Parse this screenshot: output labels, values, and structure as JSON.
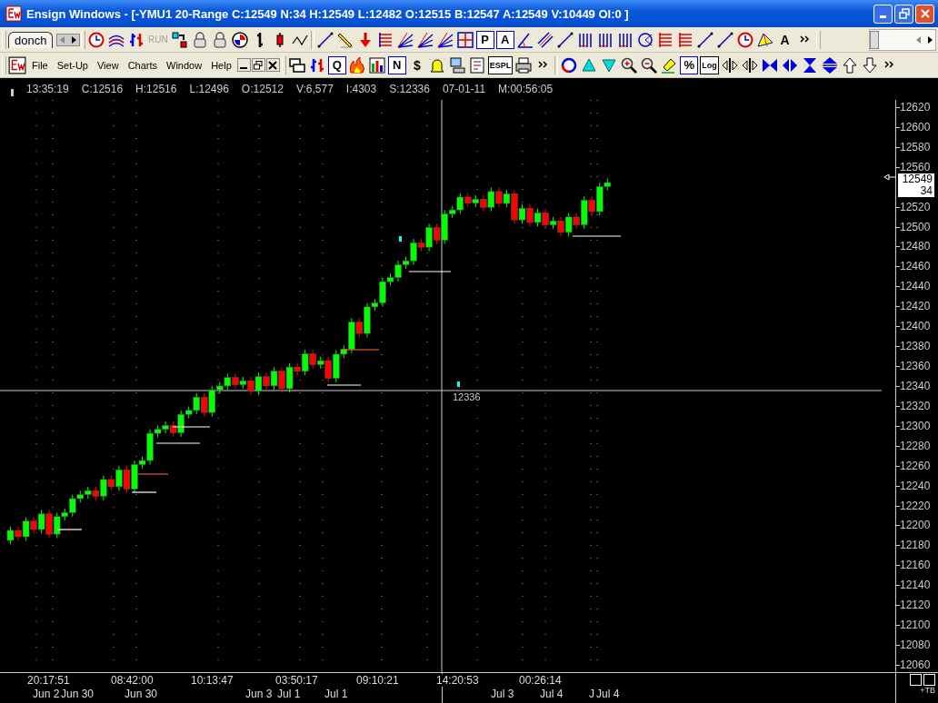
{
  "window": {
    "title": "Ensign Windows - [-YMU1 20-Range C:12549 N:34 H:12549 L:12482 O:12515 B:12547 A:12549 V:10449 OI:0 ]"
  },
  "chart_toolbar": {
    "tab": "donch",
    "glyphs": [
      "RUN",
      "P",
      "A",
      "A"
    ],
    "run_disabled": true
  },
  "menu": [
    "File",
    "Set-Up",
    "View",
    "Charts",
    "Window",
    "Help"
  ],
  "main_toolbar": {
    "glyphs": [
      "Q",
      "N",
      "$",
      "ESPL",
      "%",
      "Log"
    ]
  },
  "info_bar": [
    "13:35:19",
    "C:12516",
    "H:12516",
    "L:12496",
    "O:12512",
    "V:6,577",
    "I:4303",
    "S:12336",
    "07-01-11",
    "M:00:56:05"
  ],
  "price_axis": {
    "labels": [
      "12620",
      "12600",
      "12580",
      "12560",
      "12520",
      "12500",
      "12480",
      "12460",
      "12440",
      "12420",
      "12400",
      "12380",
      "12360",
      "12340",
      "12320",
      "12300",
      "12280",
      "12260",
      "12240",
      "12220",
      "12200",
      "12180",
      "12160",
      "12140",
      "12120",
      "12100",
      "12080",
      "12060"
    ],
    "last_price": "12549",
    "count": "34"
  },
  "crosshair": {
    "price": "12336"
  },
  "time_axis": {
    "times": [
      "20:17:51",
      "08:42:00",
      "10:13:47",
      "03:50:17",
      "09:10:21",
      "14:20:53",
      "00:26:14"
    ],
    "dates": [
      "Jun 2",
      "Jun 30",
      "Jun 30",
      "Jun 3",
      "Jul 1",
      "Jul 1",
      "Jul 3",
      "Jul 4",
      "J",
      "Jul 4"
    ],
    "corner": "+TB"
  }
}
